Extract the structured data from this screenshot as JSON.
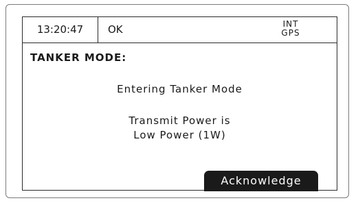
{
  "status_bar": {
    "time": "13:20:47",
    "status": "OK",
    "source_line1": "INT",
    "source_line2": "GPS"
  },
  "screen": {
    "mode_title": "TANKER MODE:",
    "message_entering": "Entering Tanker Mode",
    "message_power_line1": "Transmit Power is",
    "message_power_line2": "Low Power (1W)"
  },
  "softkeys": {
    "acknowledge_label": "Acknowledge"
  }
}
